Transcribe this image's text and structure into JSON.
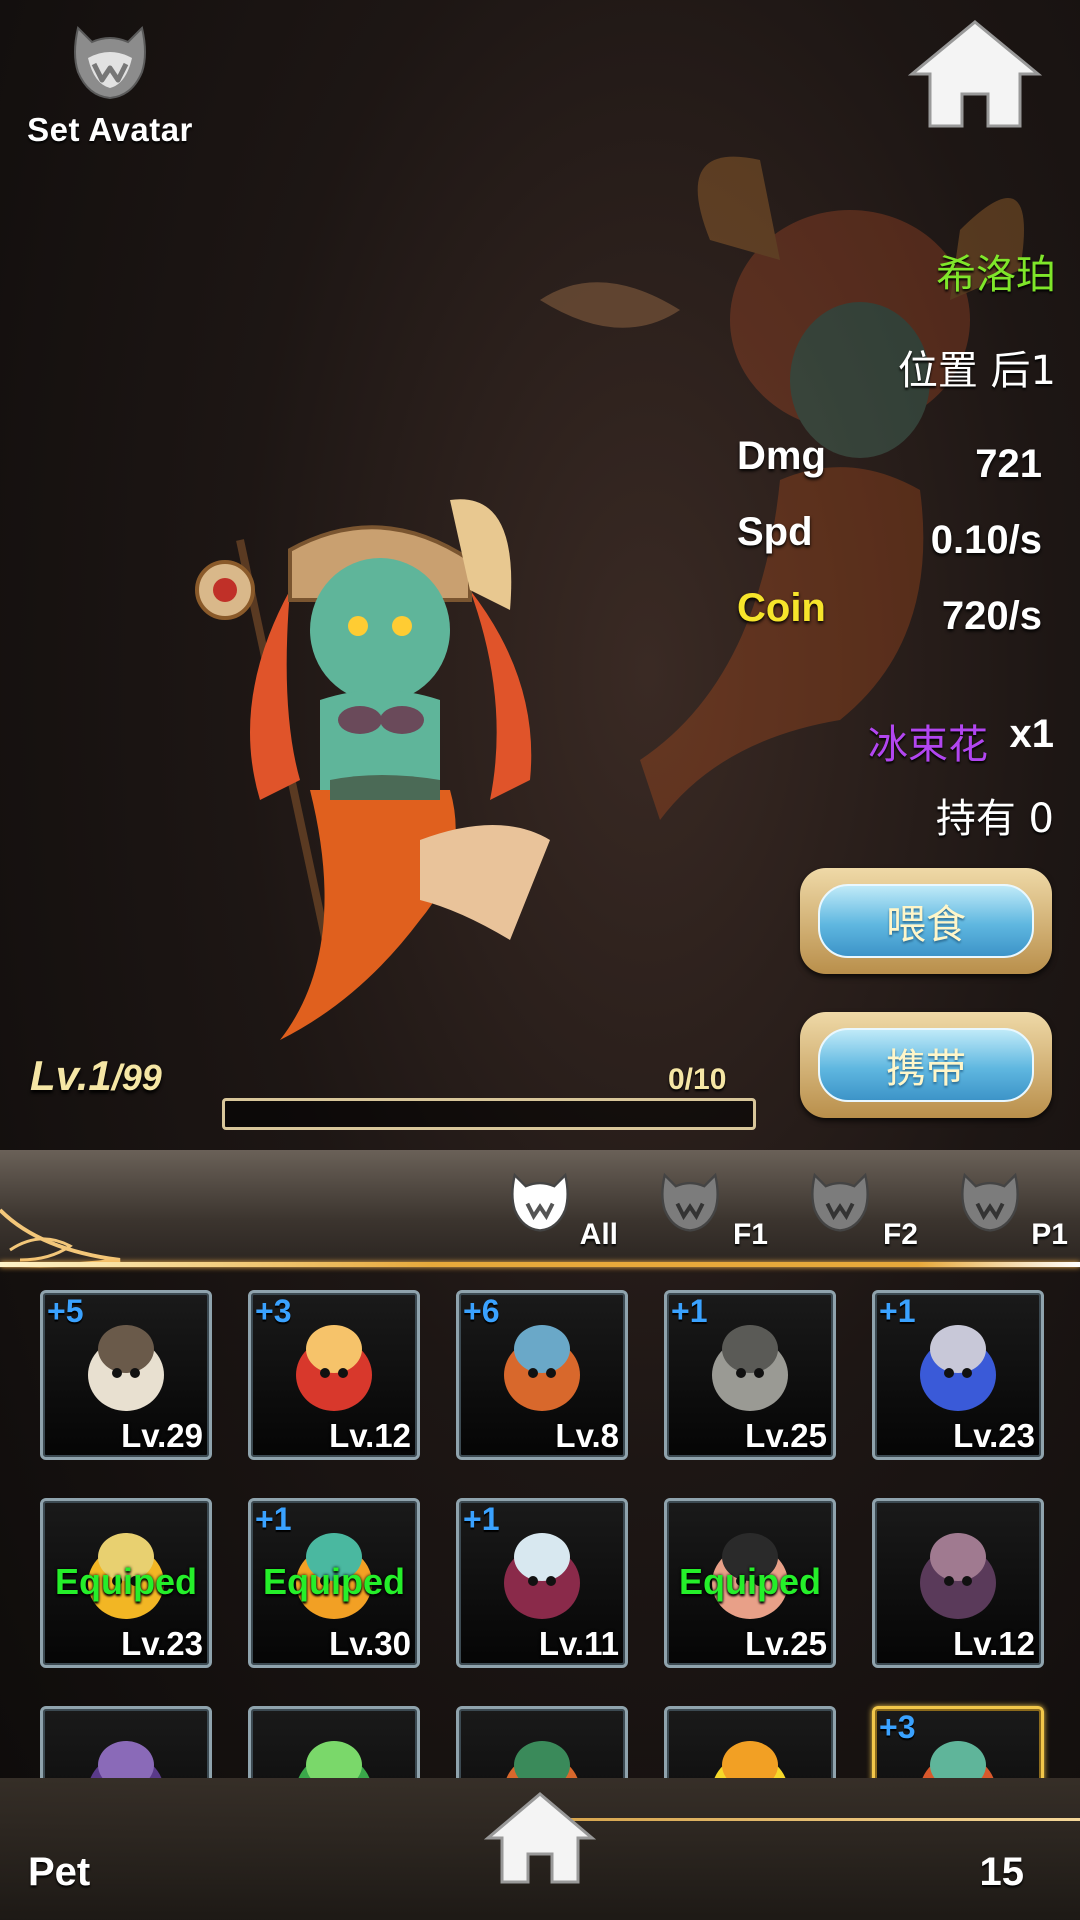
{
  "header": {
    "avatar_label": "Set Avatar"
  },
  "pet": {
    "name": "希洛珀",
    "position": "位置 后1",
    "stats": [
      {
        "label": "Dmg",
        "value": "721"
      },
      {
        "label": "Spd",
        "value": "0.10/s"
      },
      {
        "label": "Coin",
        "value": "720/s"
      }
    ],
    "item_name": "冰束花",
    "item_count": "x1",
    "hold": "持有 0",
    "level_current": "Lv.1",
    "level_max": "/99",
    "exp_text": "0/10",
    "exp_progress": 0
  },
  "buttons": {
    "feed": "喂食",
    "carry": "携带"
  },
  "tabs": [
    {
      "label": "All"
    },
    {
      "label": "F1"
    },
    {
      "label": "F2"
    },
    {
      "label": "P1"
    }
  ],
  "grid": [
    {
      "plus": "+5",
      "level": "Lv.29",
      "equipped": "",
      "art": "skull-knight"
    },
    {
      "plus": "+3",
      "level": "Lv.12",
      "equipped": "",
      "art": "mushroom"
    },
    {
      "plus": "+6",
      "level": "Lv.8",
      "equipped": "",
      "art": "crab"
    },
    {
      "plus": "+1",
      "level": "Lv.25",
      "equipped": "",
      "art": "robot-egg"
    },
    {
      "plus": "+1",
      "level": "Lv.23",
      "equipped": "",
      "art": "sword-dragon"
    },
    {
      "plus": "",
      "level": "Lv.23",
      "equipped": "Equiped",
      "art": "helmet-chick"
    },
    {
      "plus": "+1",
      "level": "Lv.30",
      "equipped": "Equiped",
      "art": "orange-bird"
    },
    {
      "plus": "+1",
      "level": "Lv.11",
      "equipped": "",
      "art": "hooded-girl"
    },
    {
      "plus": "",
      "level": "Lv.25",
      "equipped": "Equiped",
      "art": "pirate-pig"
    },
    {
      "plus": "",
      "level": "Lv.12",
      "equipped": "",
      "art": "bat-pig"
    },
    {
      "plus": "",
      "level": "",
      "equipped": "",
      "art": "purple-bat"
    },
    {
      "plus": "",
      "level": "",
      "equipped": "",
      "art": "green-sprout"
    },
    {
      "plus": "",
      "level": "",
      "equipped": "",
      "art": "orange-horn"
    },
    {
      "plus": "",
      "level": "",
      "equipped": "",
      "art": "yellow-chick"
    },
    {
      "plus": "+3",
      "level": "",
      "equipped": "",
      "art": "mermaid"
    }
  ],
  "footer": {
    "title": "Pet",
    "count": "15"
  },
  "colors": {
    "name": "#7fe62a",
    "coin": "#f6e52b",
    "item": "#b246f0",
    "plus": "#3aa2ff",
    "equipped": "#25ef2a",
    "accent": "#e7a93b"
  }
}
